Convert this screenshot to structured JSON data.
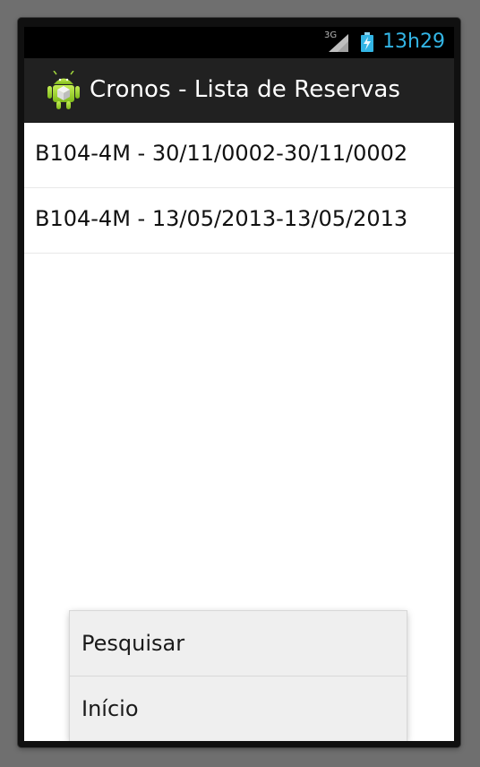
{
  "status_bar": {
    "network_type": "3G",
    "clock": "13h29",
    "icons": [
      "signal-icon",
      "battery-charging-icon"
    ],
    "clock_color": "#33b5e5"
  },
  "action_bar": {
    "app_icon": "android-app-icon",
    "title": "Cronos - Lista de Reservas",
    "background_color": "#212121"
  },
  "list": {
    "items": [
      {
        "label": "B104-4M - 30/11/0002-30/11/0002"
      },
      {
        "label": "B104-4M - 13/05/2013-13/05/2013"
      }
    ]
  },
  "options_menu": {
    "items": [
      {
        "label": "Pesquisar"
      },
      {
        "label": "Início"
      }
    ]
  }
}
